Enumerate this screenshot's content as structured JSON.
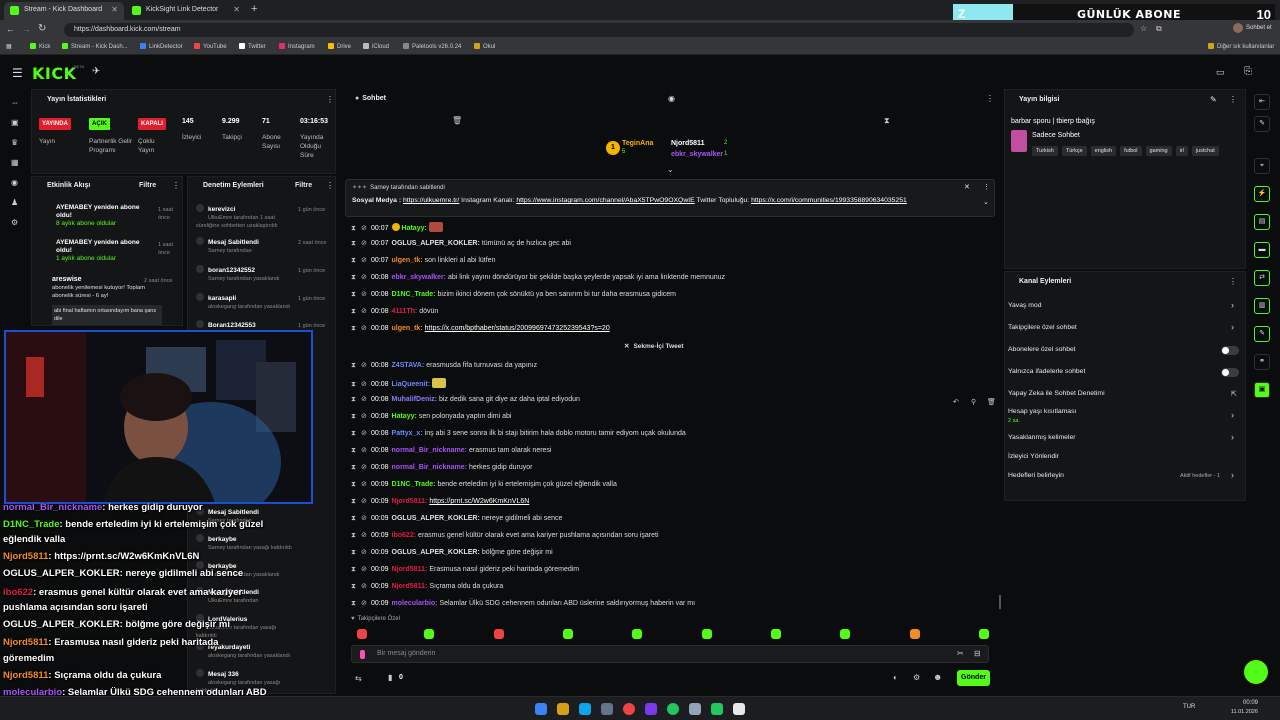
{
  "browser": {
    "tabs": [
      {
        "title": "Stream - Kick Dashboard",
        "active": true
      },
      {
        "title": "KickSight Link Detector",
        "active": false
      }
    ],
    "url": "https://dashboard.kick.com/stream",
    "bookmarks": [
      "Kick",
      "Stream - Kick Dash...",
      "LinkDetector",
      "YouTube",
      "Twitter",
      "Instagram",
      "Drive",
      "iCloud",
      "Paletools v26.0.24",
      "Okul"
    ],
    "other_bookmarks": "Diğer sık kullanılanlar",
    "profile_label": "Sohbet et"
  },
  "overlay_banner": {
    "logo": "Z",
    "text": "GÜNLÜK ABONE",
    "count": "10"
  },
  "kick": {
    "logo": "KICK",
    "beta": "BETA"
  },
  "stats": {
    "title": "Yayın İstatistikleri",
    "badges": [
      {
        "text": "YAYINDA",
        "color": "#e11d2e",
        "label": "Yayın"
      },
      {
        "text": "AÇIK",
        "color": "#53fc18",
        "label": "Partnerlik Gelir Programı"
      },
      {
        "text": "KAPALI",
        "color": "#e11d2e",
        "label": "Çoklu Yayın"
      }
    ],
    "metrics": [
      {
        "value": "145",
        "label": "İzleyici"
      },
      {
        "value": "9.299",
        "label": "Takipçi"
      },
      {
        "value": "71",
        "label": "Abone Sayısı"
      },
      {
        "value": "03:16:53",
        "label": "Yayında Olduğu Süre"
      }
    ]
  },
  "activity": {
    "title": "Etkinlik Akışı",
    "filter": "Filtre",
    "items": [
      {
        "name": "AYEMABEY yeniden abone oldu!",
        "sub": "8 aylık abone oldular",
        "time": "1 saat önce"
      },
      {
        "name": "AYEMABEY yeniden abone oldu!",
        "sub": "1 aylık abone oldular",
        "time": "1 saat önce"
      },
      {
        "name": "areswise",
        "sub": "abonelik yenilemesi kutuyor! Toplam abonelik süresi - 6 ay!",
        "time": "2 saat önce"
      },
      {
        "name": "",
        "sub": "abi final haftamın ortasındayım bana şans dile",
        "time": ""
      }
    ]
  },
  "moderation": {
    "title": "Denetim Eylemleri",
    "filter": "Filtre",
    "items": [
      {
        "name": "kerevizci",
        "sub": "UlkuEmre tarafından 1 saat süreliğine sohbetten uzaklaştırıldı",
        "time": "1 gün önce"
      },
      {
        "name": "Mesaj Sabitlendi",
        "sub": "Sarney tarafından",
        "time": "2 saat önce"
      },
      {
        "name": "boran12342552",
        "sub": "Sarney tarafından yasaklandı",
        "time": "1 gün önce"
      },
      {
        "name": "karasapli",
        "sub": "aloskegang tarafından yasaklandı",
        "time": "1 gün önce"
      },
      {
        "name": "Boran12342553",
        "sub": "",
        "time": "1 gün önce"
      },
      {
        "name": "Mesaj Sabitlendi",
        "sub": "Sarney tarafından",
        "time": ""
      },
      {
        "name": "berkaybe",
        "sub": "Sarney tarafından yasağı kaldırıldı",
        "time": ""
      },
      {
        "name": "berkaybe",
        "sub": "Sarney tarafından yasaklandı",
        "time": ""
      },
      {
        "name": "Mesaj Sabitlendi",
        "sub": "UlkuEmre tarafından",
        "time": ""
      },
      {
        "name": "LordValerius",
        "sub": "UlkuEmre tarafından yasağı kaldırıldı",
        "time": ""
      },
      {
        "name": "reyakurdayeti",
        "sub": "aloskegang tarafından yasaklandı",
        "time": ""
      },
      {
        "name": "Mesaj 336",
        "sub": "aloskegang tarafından yasağı kaldırıldı",
        "time": ""
      }
    ]
  },
  "chat": {
    "title": "Sohbet",
    "leaders": [
      {
        "rank": "1",
        "name": "TeginAna",
        "count": "5"
      },
      {
        "name": "Njord5811",
        "count": "2"
      },
      {
        "name": "ebkr_skywalker",
        "count": "1"
      }
    ],
    "pinned": {
      "by": "Sarney tarafından sabitlendi",
      "text": "Sosyal Medya : ",
      "link1": "https://ulkuemre.tr/",
      "mid": " Instagram Kanalı: ",
      "link2": "https://www.instagram.com/channel/AbaX5TPwO9OXQwIE",
      "mid2": " Twitter Topluluğu:",
      "link3": "https://x.com/i/communities/1993358890634035251"
    },
    "messages": [
      {
        "time": "00:07",
        "user": "Hatayy:",
        "color": "#53fc18",
        "text": "",
        "badge": "#f5b400"
      },
      {
        "time": "00:07",
        "user": "OGLUS_ALPER_KOKLER:",
        "color": "#e0e0e0",
        "text": "tümünü aç de hızlıca gec abi"
      },
      {
        "time": "00:07",
        "user": "ulgen_tk:",
        "color": "#f28c28",
        "text": "son linkleri al abi lütfen"
      },
      {
        "time": "00:08",
        "user": "ebkr_skywalker:",
        "color": "#a855f7",
        "text": "abi link yayını döndürüyor bir şekilde başka şeylerde yapsak iyi ama linktende memnunuz"
      },
      {
        "time": "00:08",
        "user": "D1NC_Trade:",
        "color": "#53fc18",
        "text": "bizim ikinci dönem çok sönüktü ya ben sanırım bi tur daha erasmusa gidicem"
      },
      {
        "time": "00:08",
        "user": "4111Th:",
        "color": "#e11d48",
        "text": "dövün"
      },
      {
        "time": "00:08",
        "user": "ulgen_tk:",
        "color": "#f28c28",
        "text": "",
        "link": "https://x.com/bpthaber/status/2009969747325239543?s=20"
      },
      {
        "time": "00:08",
        "user": "Z4STAVA:",
        "color": "#6b8cff",
        "text": "erasmusda fifa turnuvası da yapınız"
      },
      {
        "time": "00:08",
        "user": "LiaQueenit:",
        "color": "#6b8cff",
        "text": ""
      },
      {
        "time": "00:08",
        "user": "MuhalifDeniz:",
        "color": "#8b7cf6",
        "text": "biz dedik sana git diye az daha iptal ediyodun"
      },
      {
        "time": "00:08",
        "user": "Hatayy:",
        "color": "#53fc18",
        "text": "sen polonyada yaptın dimi abi"
      },
      {
        "time": "00:08",
        "user": "Pattyx_x:",
        "color": "#6b8cff",
        "text": "inş abi 3 sene sonra ilk bi stajı bitirim hala doblo motoru tamir ediyom uçak okulunda"
      },
      {
        "time": "00:08",
        "user": "normal_Bir_nickname:",
        "color": "#a855f7",
        "text": "erasmus tam olarak neresi"
      },
      {
        "time": "00:08",
        "user": "normal_Bir_nickname:",
        "color": "#a855f7",
        "text": "herkes gidip duruyor"
      },
      {
        "time": "00:09",
        "user": "D1NC_Trade:",
        "color": "#53fc18",
        "text": "bende erteledim iyi ki ertelemişim çok güzel eğlendik valla"
      },
      {
        "time": "00:09",
        "user": "Njord5811:",
        "color": "#e11d48",
        "text": "",
        "link": "https://prnt.sc/W2w6KmKnVL6N"
      },
      {
        "time": "00:09",
        "user": "OGLUS_ALPER_KOKLER:",
        "color": "#e0e0e0",
        "text": "nereye gidilmeli abi sence"
      },
      {
        "time": "00:09",
        "user": "ibo622:",
        "color": "#e11d48",
        "text": "erasmus genel kültür olarak evet ama kariyer pushlama açısından soru işareti"
      },
      {
        "time": "00:09",
        "user": "OGLUS_ALPER_KOKLER:",
        "color": "#e0e0e0",
        "text": "bölğme göre değişir mi"
      },
      {
        "time": "00:09",
        "user": "Njord5811:",
        "color": "#e11d48",
        "text": "Erasmusa nasıl gideriz peki haritada göremedim"
      },
      {
        "time": "00:09",
        "user": "Njord5811:",
        "color": "#e11d48",
        "text": "Sıçrama oldu da çukura"
      },
      {
        "time": "00:09",
        "user": "molecularbio:",
        "color": "#a855f7",
        "text": "Selamlar Ülkü SDG cehennem odunları ABD üslerine saldırıyormuş haberin var mı"
      }
    ],
    "embedded_tweet": "Sekme-İçi Tweet",
    "emote_label": "Takipçilere Özel",
    "input_placeholder": "Bir mesaj gönderin",
    "send": "Gönder",
    "points": "0"
  },
  "stream_info": {
    "title": "Yayın bilgisi",
    "stream_title": "barbar sporu | tbierp tbağış",
    "category": "Sadece Sohbet",
    "tags": [
      "Turkish",
      "Türkçe",
      "english",
      "futbol",
      "gaming",
      "irl",
      "justchat"
    ]
  },
  "channel_actions": {
    "title": "Kanal Eylemleri",
    "items": [
      {
        "label": "Yavaş mod",
        "control": "chevron"
      },
      {
        "label": "Takipçilere özel sohbet",
        "control": "chevron"
      },
      {
        "label": "Abonelere özel sohbet",
        "control": "toggle"
      },
      {
        "label": "Yalnızca ifadelerle sohbet",
        "control": "toggle"
      },
      {
        "label": "Yapay Zeka ile Sohbet Denetimi",
        "control": "external"
      },
      {
        "label": "Hesap yaşı kısıtlaması",
        "sub": "2 sa.",
        "control": "chevron"
      },
      {
        "label": "Yasaklanmış kelimeler",
        "control": "chevron"
      },
      {
        "label": "İzleyici Yönlendir",
        "control": "none"
      },
      {
        "label": "Hedefleri belirleyin",
        "sub": "Aktif hedefler - 1",
        "control": "chevron"
      }
    ]
  },
  "overlay_chat": [
    {
      "user": "normal_Bir_nickname",
      "text": ": herkes gidip duruyor",
      "color": "#a855f7"
    },
    {
      "user": "D1NC_Trade",
      "text": ": bende erteledim iyi ki ertelemişim çok güzel",
      "color": "#53fc18"
    },
    {
      "user": "",
      "text": "eğlendik valla",
      "color": "#fff"
    },
    {
      "user": "Njord5811",
      "text": ": https://prnt.sc/W2w6KmKnVL6N",
      "color": "#f28c28"
    },
    {
      "user": "OGLUS_ALPER_KOKLER",
      "text": ": nereye gidilmeli abi sence",
      "color": "#fff"
    },
    {
      "user": "ibo622",
      "text": ": erasmus genel kültür olarak evet ama kariyer",
      "color": "#e11d48"
    },
    {
      "user": "",
      "text": "pushlama açısından soru işareti",
      "color": "#fff"
    },
    {
      "user": "OGLUS_ALPER_KOKLER",
      "text": ": bölğme göre değişir mi",
      "color": "#fff"
    },
    {
      "user": "Njord5811",
      "text": ": Erasmusa nasıl gideriz peki haritada",
      "color": "#f28c28"
    },
    {
      "user": "",
      "text": "göremedim",
      "color": "#fff"
    },
    {
      "user": "Njord5811",
      "text": ": Sıçrama oldu da çukura",
      "color": "#f28c28"
    },
    {
      "user": "molecularbio",
      "text": ": Selamlar Ülkü SDG cehennem odunları ABD",
      "color": "#a855f7"
    },
    {
      "user": "",
      "text": "üslerine saldırıyormuş haberin var mı",
      "color": "#fff"
    }
  ],
  "taskbar": {
    "time": "00:09",
    "date": "11.01.2026",
    "lang": "TUR"
  }
}
